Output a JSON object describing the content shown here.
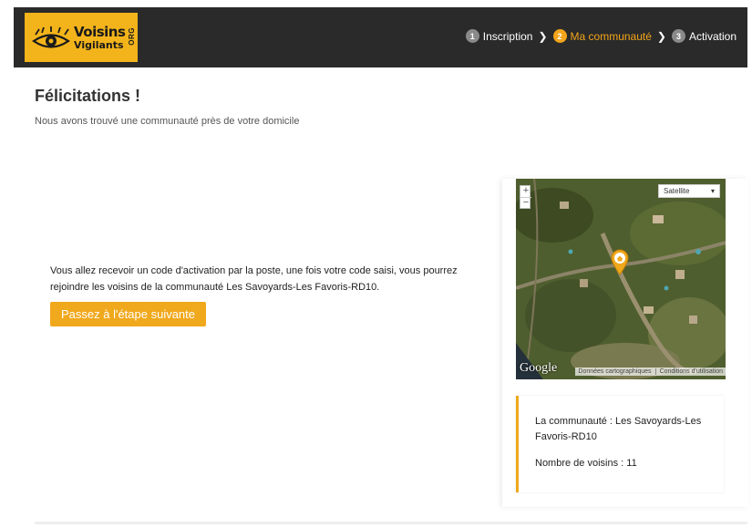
{
  "header": {
    "logo": {
      "line1": "Voisins",
      "line2": "Vigilants",
      "suffix": "ORG"
    },
    "steps": [
      {
        "num": "1",
        "label": "Inscription",
        "active": false
      },
      {
        "num": "2",
        "label": "Ma communauté",
        "active": true
      },
      {
        "num": "3",
        "label": "Activation",
        "active": false
      }
    ]
  },
  "main": {
    "title": "Félicitations !",
    "subtitle": "Nous avons trouvé une communauté près de votre domicile",
    "message": "Vous allez recevoir un code d'activation par la poste, une fois votre code saisi, vous pourrez rejoindre les voisins de la communauté Les Savoyards-Les Favoris-RD10.",
    "next_button": "Passez à l'étape suivante"
  },
  "map": {
    "zoom_in": "+",
    "zoom_out": "−",
    "map_type": "Satellite",
    "google": "Google",
    "attribution_data": "Données cartographiques",
    "attribution_terms": "Conditions d'utilisation"
  },
  "info": {
    "community": "La communauté : Les Savoyards-Les Favoris-RD10",
    "neighbors": "Nombre de voisins : 11"
  },
  "colors": {
    "accent": "#f0a81c",
    "header_bg": "#2a2a2a",
    "logo_bg": "#f3b41b"
  },
  "icons": {
    "logo": "eye-icon",
    "marker": "home-marker-icon",
    "chevron": "chevron-right-icon",
    "dropdown": "caret-down-icon"
  }
}
